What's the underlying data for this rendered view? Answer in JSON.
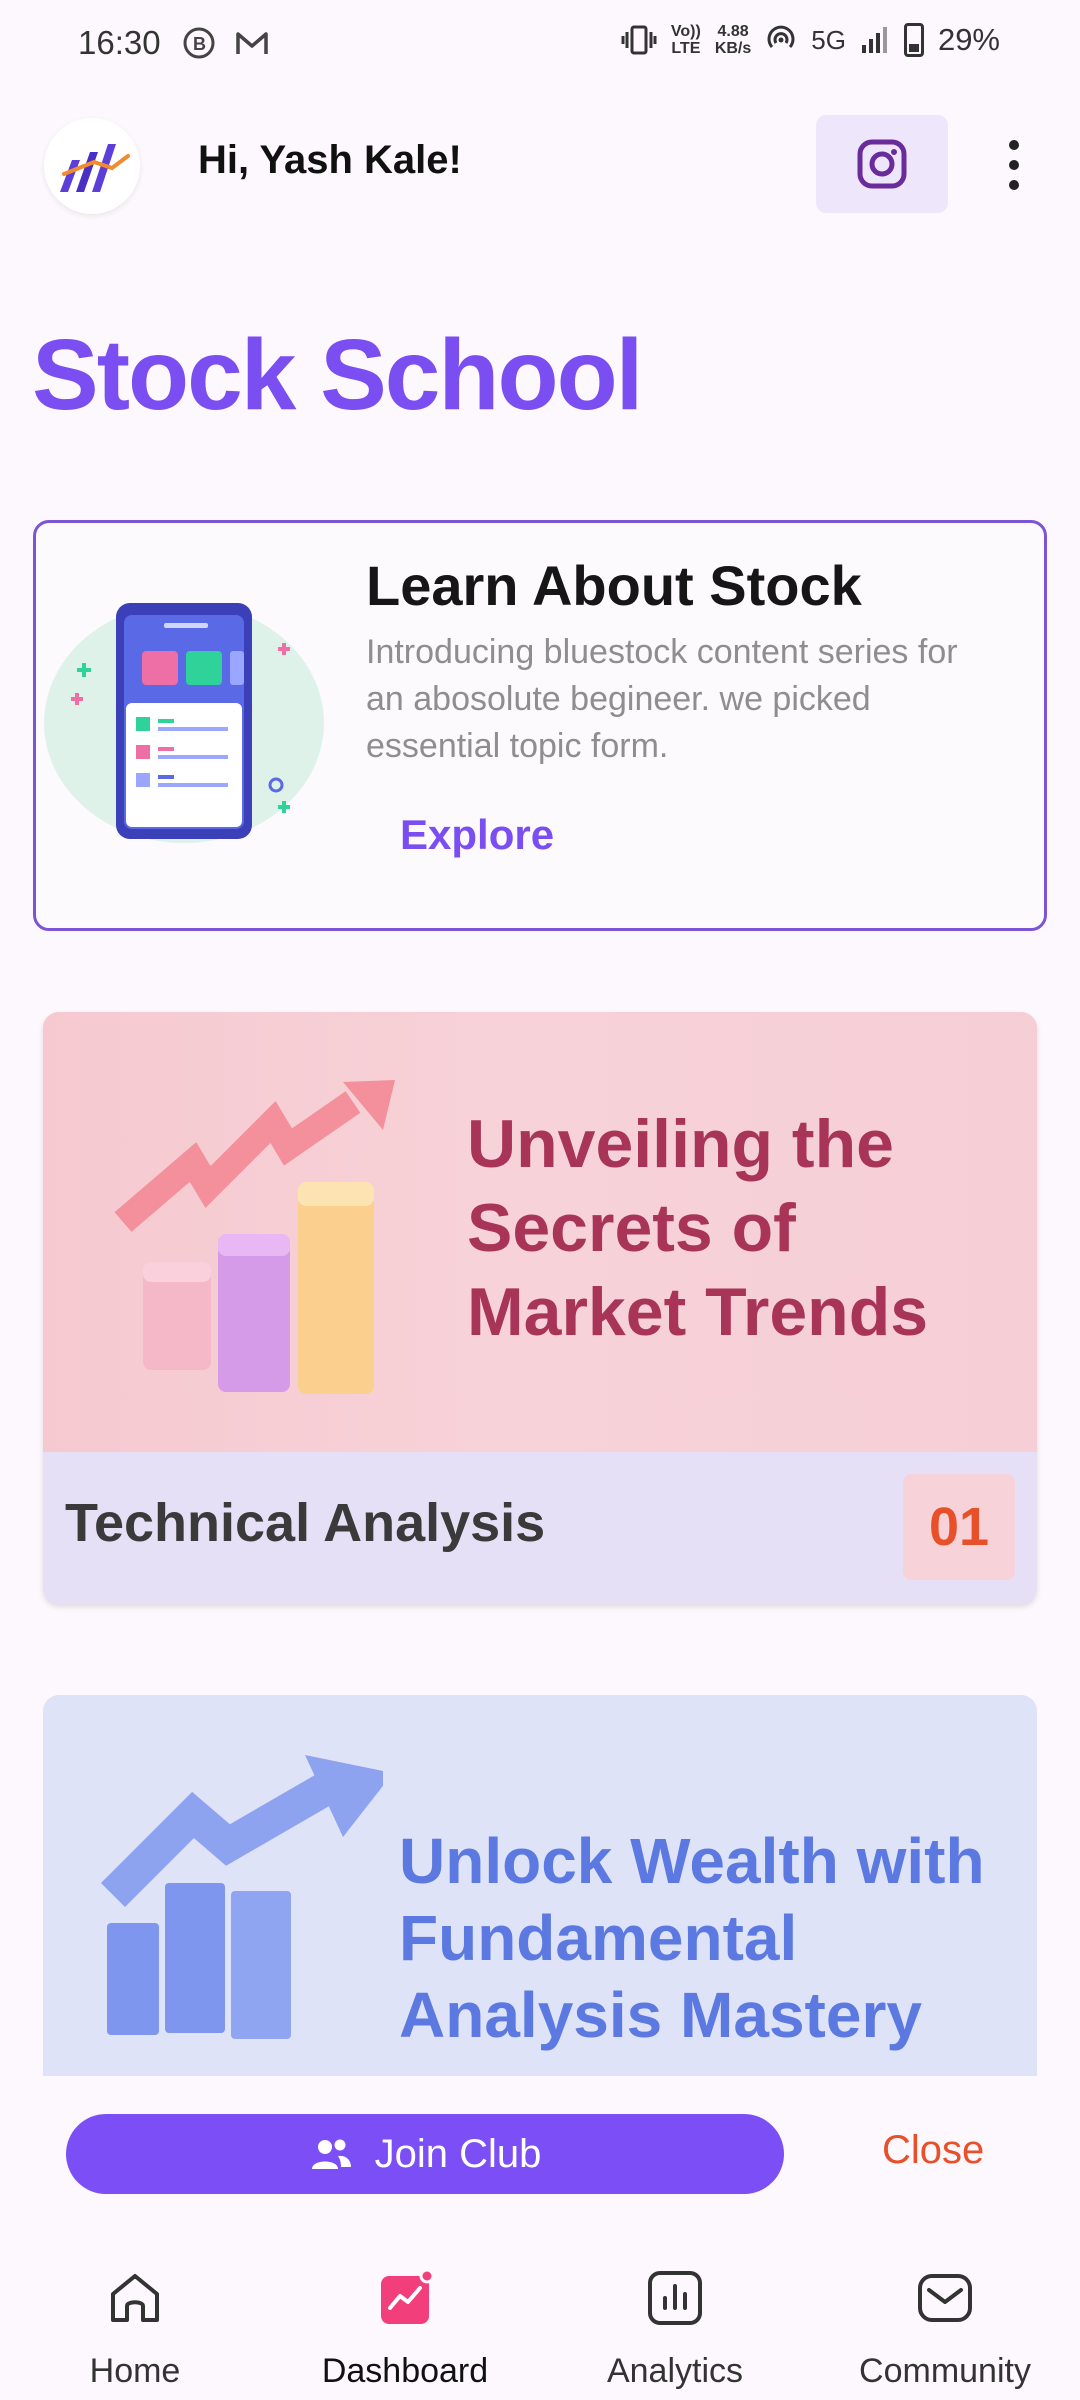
{
  "status_bar": {
    "time": "16:30",
    "network_speed_value": "4.88",
    "network_speed_unit": "KB/s",
    "volte_top": "Vo))",
    "volte_bottom": "LTE",
    "network": "5G",
    "battery": "29%"
  },
  "header": {
    "greeting": "Hi, Yash Kale!"
  },
  "page_title": "Stock School",
  "learn_card": {
    "title": "Learn About Stock",
    "description": "Introducing bluestock content series for an abosolute begineer. we picked essential topic form.",
    "action": "Explore"
  },
  "courses": [
    {
      "banner_text": "Unveiling the Secrets of Market Trends",
      "name": "Technical Analysis",
      "number": "01"
    },
    {
      "banner_text": "Unlock Wealth with Fundamental Analysis Mastery"
    }
  ],
  "join_bar": {
    "join_label": "Join Club",
    "close_label": "Close"
  },
  "bottom_nav": [
    {
      "label": "Home",
      "icon": "home-icon"
    },
    {
      "label": "Dashboard",
      "icon": "dashboard-icon",
      "active": true
    },
    {
      "label": "Analytics",
      "icon": "analytics-icon"
    },
    {
      "label": "Community",
      "icon": "community-icon"
    }
  ],
  "colors": {
    "accent": "#7a4ef0",
    "close": "#e8502a",
    "trend_text": "#a83557",
    "fundamental_text": "#5b79e0"
  }
}
